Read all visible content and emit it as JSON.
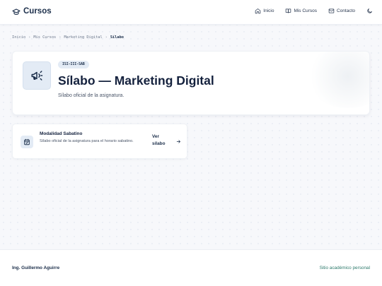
{
  "header": {
    "brand": "Cursos",
    "nav": [
      {
        "label": "Inicio",
        "icon": "home-icon"
      },
      {
        "label": "Mis Cursos",
        "icon": "book-icon"
      },
      {
        "label": "Contacto",
        "icon": "mail-icon"
      }
    ],
    "theme_icon": "moon-icon"
  },
  "breadcrumb": {
    "items": [
      "Inicio",
      "Mis Cursos",
      "Marketing Digital"
    ],
    "current": "Sílabo"
  },
  "hero": {
    "badge": "ISI-III-SAB",
    "title": "Sílabo — Marketing Digital",
    "subtitle": "Sílabo oficial de la asignatura.",
    "icon": "megaphone-icon"
  },
  "card": {
    "title": "Modalidad Sabatino",
    "description": "Sílabo oficial de la asignatura para el horario sabatino.",
    "link_label": "Ver sílabo",
    "icon": "calendar-icon"
  },
  "footer": {
    "author": "Ing. Guillermo Aguirre",
    "site": "Sitio académico personal"
  },
  "colors": {
    "primary": "#1b2e4a",
    "accent_light": "#e3ebf5",
    "footer_link": "#2e7a6c"
  }
}
